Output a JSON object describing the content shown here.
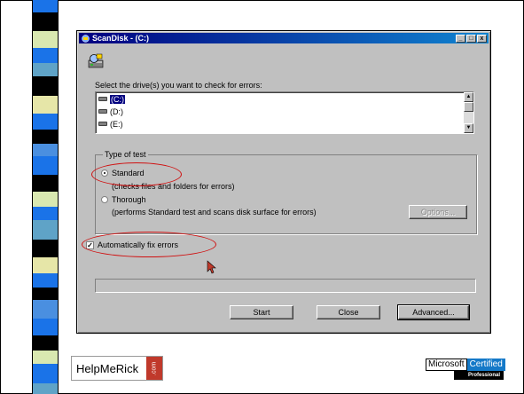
{
  "window": {
    "title": "ScanDisk - (C:)",
    "buttons": [
      "_",
      "□",
      "x"
    ]
  },
  "drives": {
    "prompt": "Select the drive(s) you want to check for errors:",
    "items": [
      {
        "label": "(C:)",
        "selected": true
      },
      {
        "label": "(D:)",
        "selected": false
      },
      {
        "label": "(E:)",
        "selected": false
      }
    ]
  },
  "test_type": {
    "title": "Type of test",
    "standard": {
      "label": "Standard",
      "description": "(checks files and folders for errors)",
      "selected": true
    },
    "thorough": {
      "label": "Thorough",
      "description": "(performs Standard test and scans disk surface for errors)",
      "selected": false
    },
    "options_button": "Options..."
  },
  "auto_fix": {
    "label": "Automatically fix errors",
    "checked": true
  },
  "buttons": {
    "start": "Start",
    "close": "Close",
    "advanced": "Advanced..."
  },
  "logos": {
    "left": {
      "text": "HelpMeRick",
      "suffix": ".com"
    },
    "right": {
      "line1a": "Microsoft",
      "line1b": "Certified",
      "line2": "Professional"
    }
  },
  "colors": {
    "annotation": "#d01010",
    "title_bar": "#000080",
    "dialog_face": "#c0c0c0"
  }
}
